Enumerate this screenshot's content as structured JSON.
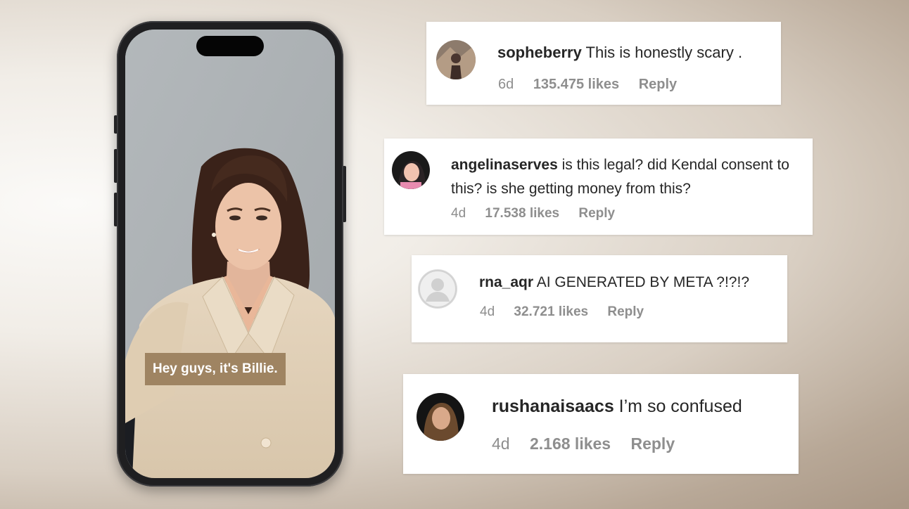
{
  "video": {
    "caption": "Hey guys, it's Billie."
  },
  "comments": [
    {
      "user": "sopheberry",
      "text": "This is honestly scary .",
      "age": "6d",
      "likes": "135.475 likes",
      "reply": "Reply",
      "avatar_icon": "photo-avatar-icon"
    },
    {
      "user": "angelinaserves",
      "text": "is this legal? did Kendal consent to this? is she getting money from this?",
      "age": "4d",
      "likes": "17.538 likes",
      "reply": "Reply",
      "avatar_icon": "cartoon-avatar-icon"
    },
    {
      "user": "rna_aqr",
      "text": "AI GENERATED BY META ?!?!?",
      "age": "4d",
      "likes": "32.721 likes",
      "reply": "Reply",
      "avatar_icon": "default-user-icon"
    },
    {
      "user": "rushanaisaacs",
      "text": "I’m so confused",
      "age": "4d",
      "likes": "2.168 likes",
      "reply": "Reply",
      "avatar_icon": "photo-avatar-icon"
    }
  ]
}
